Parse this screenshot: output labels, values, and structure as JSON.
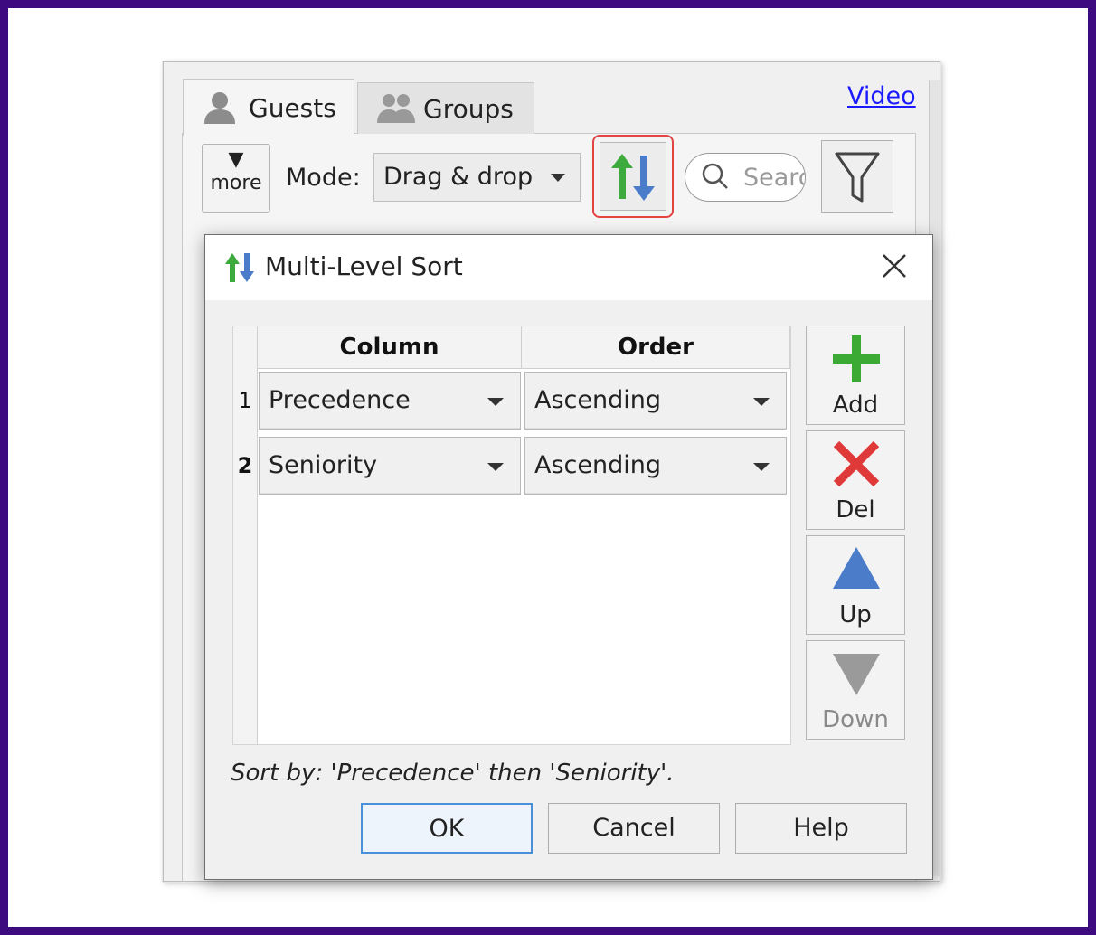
{
  "tabs": [
    {
      "label": "Guests",
      "icon": "person-icon"
    },
    {
      "label": "Groups",
      "icon": "people-icon"
    }
  ],
  "video_link": "Video",
  "toolbar": {
    "more_label": "more",
    "more_glyph": "▼",
    "mode_label": "Mode:",
    "mode_value": "Drag & drop",
    "search_placeholder": "Search"
  },
  "dialog": {
    "title": "Multi-Level Sort",
    "columns": [
      "Column",
      "Order"
    ],
    "rows": [
      {
        "num": "1",
        "column": "Precedence",
        "order": "Ascending"
      },
      {
        "num": "2",
        "column": "Seniority",
        "order": "Ascending"
      }
    ],
    "side_buttons": {
      "add": "Add",
      "del": "Del",
      "up": "Up",
      "down": "Down"
    },
    "sort_by_text": "Sort by: 'Precedence' then 'Seniority'.",
    "buttons": {
      "ok": "OK",
      "cancel": "Cancel",
      "help": "Help"
    }
  },
  "colors": {
    "frame": "#3d0a7f",
    "highlight": "#e24444",
    "arrow_up": "#3daa3d",
    "arrow_down": "#4a7cc9",
    "add": "#3aaa35",
    "del": "#e0393a",
    "up": "#4a7cc9",
    "link": "#1a1aff"
  }
}
